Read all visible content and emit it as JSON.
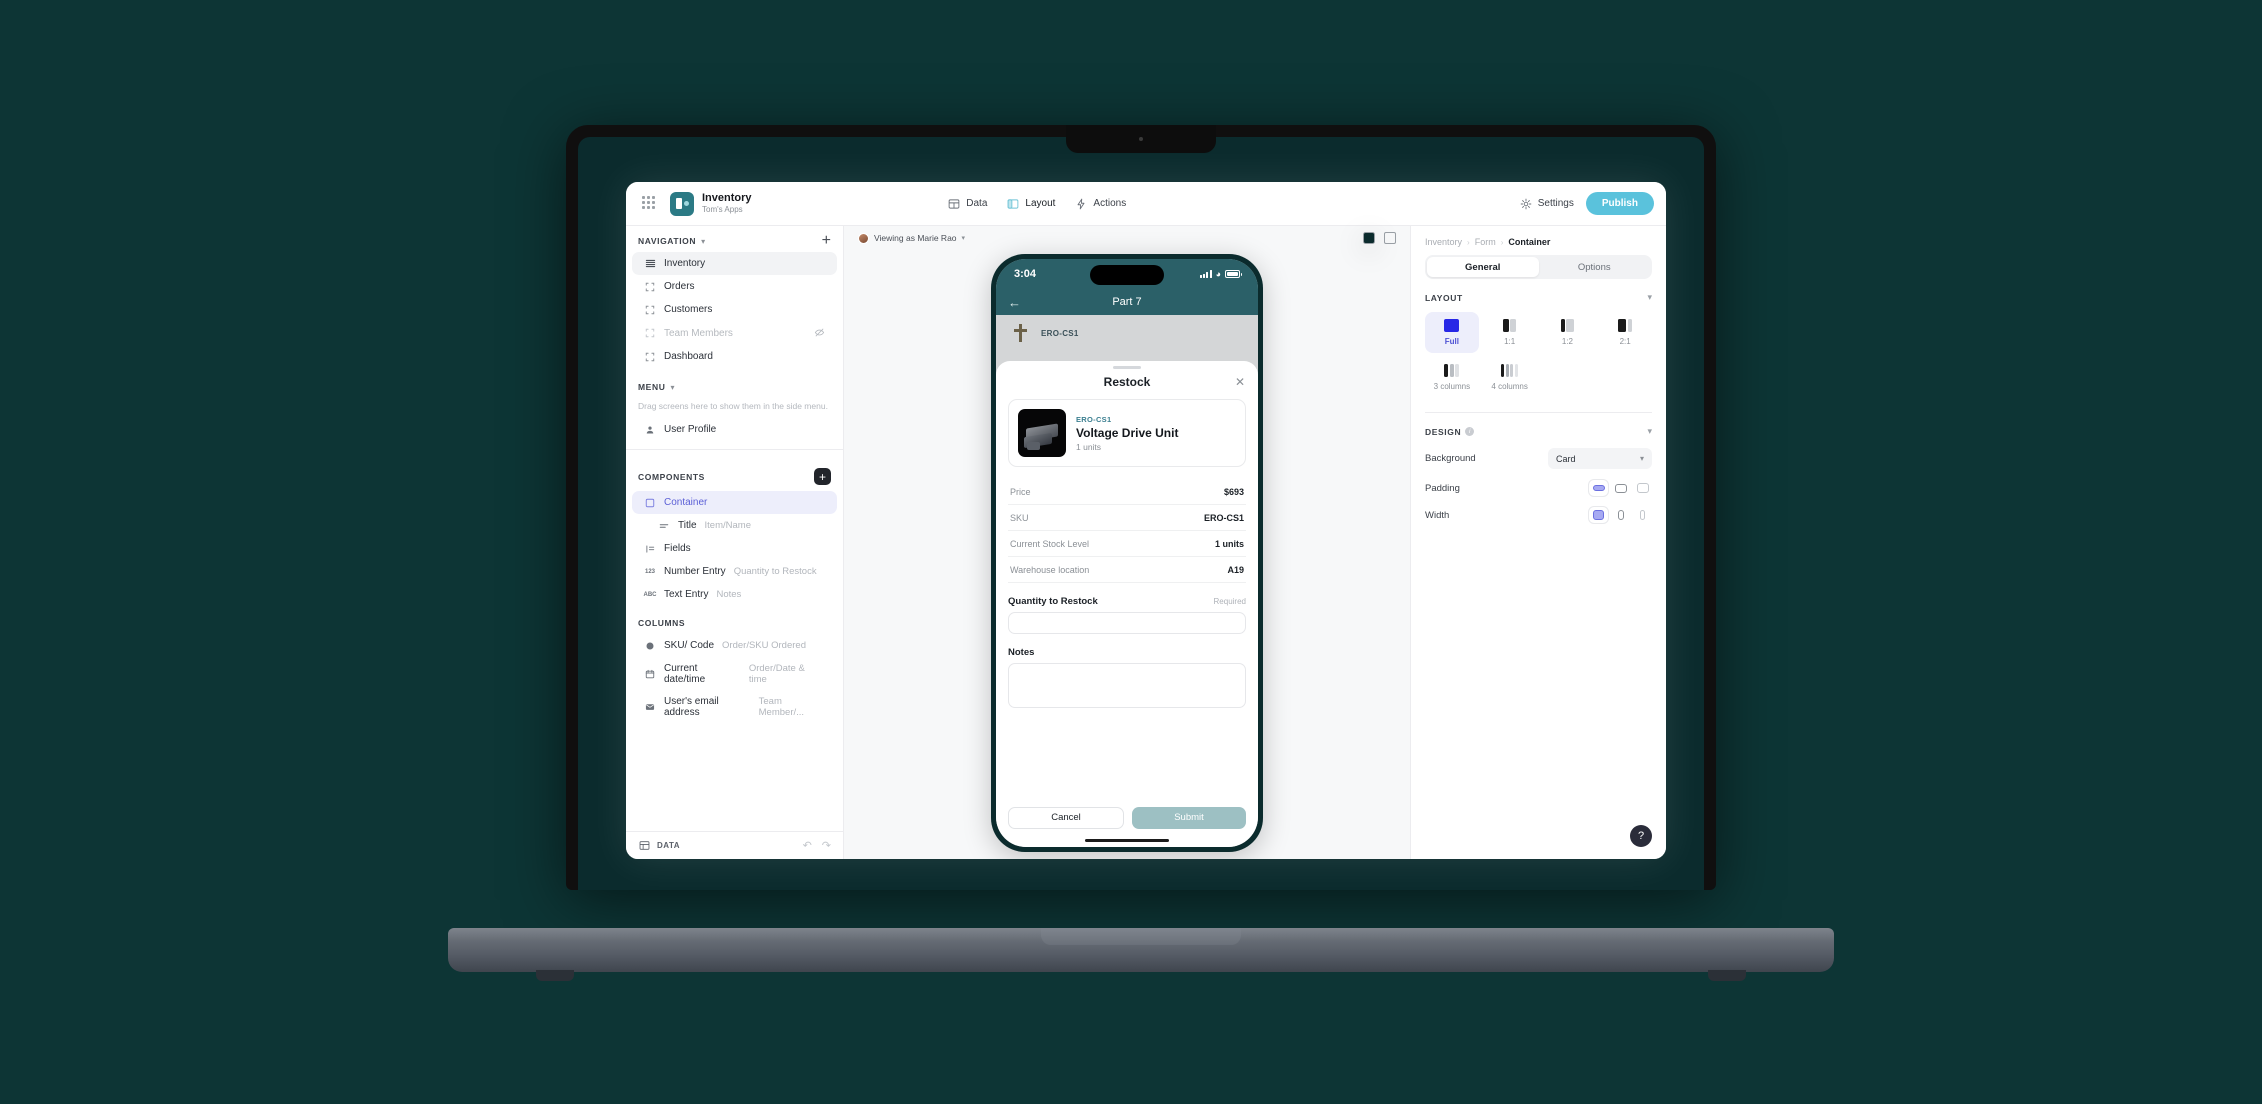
{
  "app": {
    "title": "Inventory",
    "subtitle": "Tom's Apps",
    "grid_icon": "grid-dots-icon",
    "logo_icon": "app-logo-icon"
  },
  "topbar": {
    "nav": [
      {
        "label": "Data",
        "icon": "table-icon",
        "active": false
      },
      {
        "label": "Layout",
        "icon": "layout-icon",
        "active": true
      },
      {
        "label": "Actions",
        "icon": "bolt-icon",
        "active": false
      }
    ],
    "settings_label": "Settings",
    "settings_icon": "gear-icon",
    "publish_label": "Publish",
    "publish_color": "#5ac2dc"
  },
  "sidebar": {
    "navigation": {
      "title": "NAVIGATION",
      "add_icon": "plus-icon",
      "items": [
        {
          "label": "Inventory",
          "icon": "list-icon",
          "state": "selected"
        },
        {
          "label": "Orders",
          "icon": "frame-icon",
          "state": "normal"
        },
        {
          "label": "Customers",
          "icon": "frame-icon",
          "state": "normal"
        },
        {
          "label": "Team Members",
          "icon": "frame-icon",
          "state": "hidden",
          "trailing_icon": "eye-off-icon"
        },
        {
          "label": "Dashboard",
          "icon": "frame-icon",
          "state": "normal"
        }
      ]
    },
    "menu": {
      "title": "MENU",
      "hint": "Drag screens here to show them in the side menu.",
      "items": [
        {
          "label": "User Profile",
          "icon": "person-icon"
        }
      ]
    },
    "components": {
      "title": "COMPONENTS",
      "add_icon": "plus-icon",
      "items": [
        {
          "label": "Container",
          "sub": "",
          "icon": "square-icon",
          "state": "selected"
        },
        {
          "label": "Title",
          "sub": "Item/Name",
          "icon": "text-lines-icon",
          "indent": true
        },
        {
          "label": "Fields",
          "sub": "",
          "icon": "fields-icon"
        },
        {
          "label": "Number Entry",
          "sub": "Quantity to Restock",
          "icon": "number-icon"
        },
        {
          "label": "Text Entry",
          "sub": "Notes",
          "icon": "abc-icon"
        }
      ]
    },
    "columns": {
      "title": "COLUMNS",
      "items": [
        {
          "label": "SKU/ Code",
          "sub": "Order/SKU Ordered",
          "icon": "circle-icon"
        },
        {
          "label": "Current date/time",
          "sub": "Order/Date & time",
          "icon": "calendar-icon"
        },
        {
          "label": "User's email address",
          "sub": "Team Member/...",
          "icon": "mail-icon"
        }
      ]
    },
    "footer": {
      "label": "DATA",
      "icon": "table-icon",
      "undo_icon": "undo-icon",
      "redo_icon": "redo-icon"
    }
  },
  "canvas": {
    "viewing_as": "Viewing as Marie Rao",
    "viewing_chevron": "chevron-down-icon",
    "avatar": "user-avatar",
    "preview_phone_icon": "phone-preview-icon",
    "preview_desktop_icon": "desktop-preview-icon"
  },
  "phone": {
    "status": {
      "time": "3:04",
      "signal_icon": "cellular-bars-icon",
      "wifi_icon": "wifi-icon",
      "battery_icon": "battery-icon"
    },
    "header": {
      "back_icon": "back-arrow-icon",
      "title": "Part 7"
    },
    "background_row": {
      "sku": "ERO-CS1",
      "icon": "part-thumbnail-icon"
    },
    "sheet": {
      "title": "Restock",
      "close_icon": "close-icon",
      "product": {
        "sku": "ERO-CS1",
        "name": "Voltage Drive Unit",
        "units": "1 units",
        "image": "voltage-drive-unit-photo"
      },
      "details": [
        {
          "key": "Price",
          "value": "$693"
        },
        {
          "key": "SKU",
          "value": "ERO-CS1"
        },
        {
          "key": "Current Stock Level",
          "value": "1 units"
        },
        {
          "key": "Warehouse location",
          "value": "A19"
        }
      ],
      "fields": [
        {
          "label": "Quantity to Restock",
          "required_label": "Required",
          "value": "",
          "tall": false
        },
        {
          "label": "Notes",
          "required_label": "",
          "value": "",
          "tall": true
        }
      ],
      "cancel_label": "Cancel",
      "submit_label": "Submit"
    }
  },
  "inspector": {
    "breadcrumb": [
      "Inventory",
      "Form",
      "Container"
    ],
    "tabs": [
      {
        "label": "General",
        "active": true
      },
      {
        "label": "Options",
        "active": false
      }
    ],
    "layout": {
      "title": "LAYOUT",
      "chevron": "chevron-down-icon",
      "options": [
        {
          "label": "Full",
          "active": true,
          "glyph": "full"
        },
        {
          "label": "1:1",
          "active": false,
          "glyph": "1-1"
        },
        {
          "label": "1:2",
          "active": false,
          "glyph": "1-2"
        },
        {
          "label": "2:1",
          "active": false,
          "glyph": "2-1"
        },
        {
          "label": "3 columns",
          "active": false,
          "glyph": "3col"
        },
        {
          "label": "4 columns",
          "active": false,
          "glyph": "4col"
        }
      ]
    },
    "design": {
      "title": "DESIGN",
      "info_icon": "info-icon",
      "chevron": "chevron-down-icon",
      "background": {
        "label": "Background",
        "value": "Card",
        "chevron": "chevron-down-icon"
      },
      "padding": {
        "label": "Padding",
        "selected_index": 0
      },
      "width": {
        "label": "Width",
        "selected_index": 0
      }
    },
    "help_label": "?"
  }
}
